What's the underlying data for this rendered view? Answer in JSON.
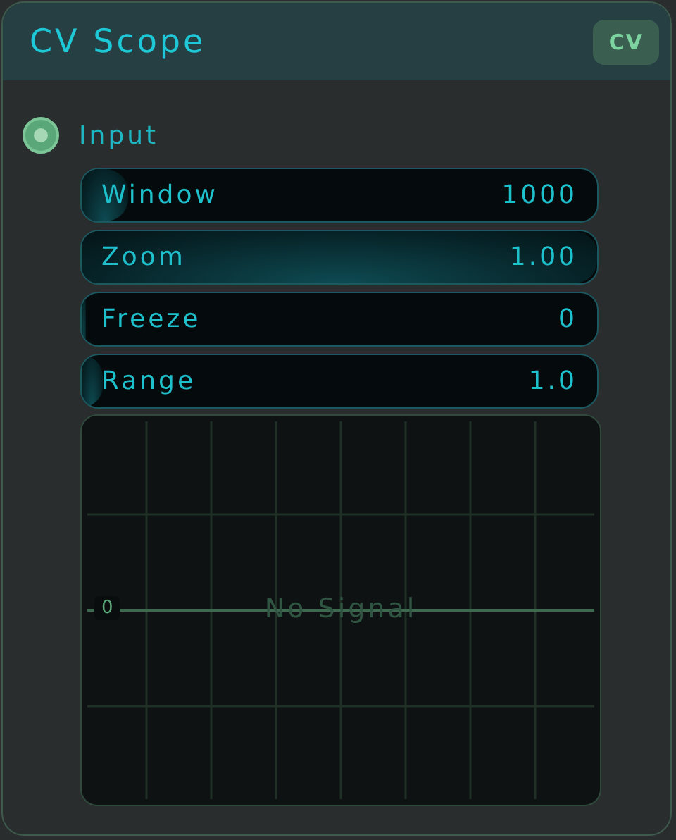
{
  "title": "CV Scope",
  "badge": "CV",
  "input": {
    "label": "Input"
  },
  "sliders": [
    {
      "label": "Window",
      "value": "1000",
      "level": 0.09
    },
    {
      "label": "Zoom",
      "value": "1.00",
      "level": 1
    },
    {
      "label": "Freeze",
      "value": "0",
      "level": 0
    },
    {
      "label": "Range",
      "value": "1.0",
      "level": 0.04
    }
  ],
  "scope": {
    "zero_label": "0",
    "message": "No Signal"
  }
}
